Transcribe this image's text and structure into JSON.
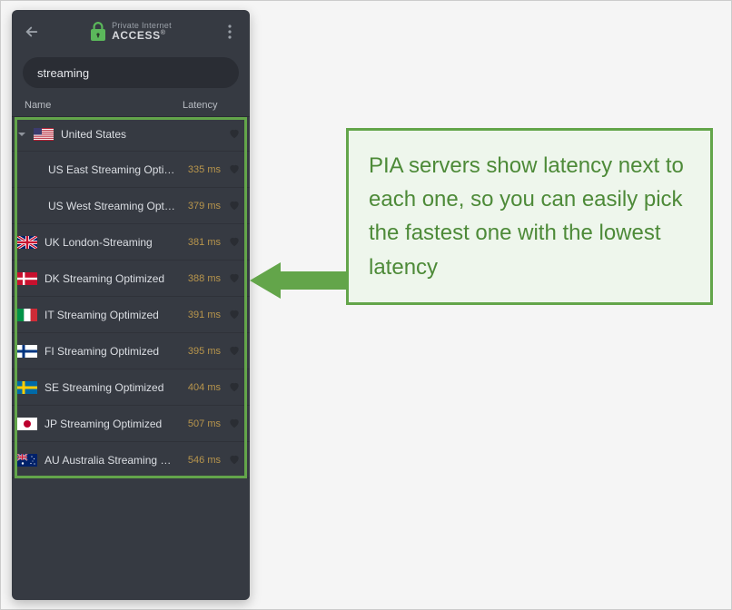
{
  "brand": {
    "line1": "Private Internet",
    "line2": "ACCESS",
    "reg": "®"
  },
  "search": {
    "value": "streaming"
  },
  "columns": {
    "name": "Name",
    "latency": "Latency"
  },
  "group": {
    "label": "United States",
    "flag": "us",
    "children": [
      {
        "name": "US East Streaming Optimiz…",
        "latency": "335 ms"
      },
      {
        "name": "US West Streaming Optimiz…",
        "latency": "379 ms"
      }
    ]
  },
  "servers": [
    {
      "flag": "uk",
      "name": "UK London-Streaming",
      "latency": "381 ms"
    },
    {
      "flag": "dk",
      "name": "DK Streaming Optimized",
      "latency": "388 ms"
    },
    {
      "flag": "it",
      "name": "IT Streaming Optimized",
      "latency": "391 ms"
    },
    {
      "flag": "fi",
      "name": "FI Streaming Optimized",
      "latency": "395 ms"
    },
    {
      "flag": "se",
      "name": "SE Streaming Optimized",
      "latency": "404 ms"
    },
    {
      "flag": "jp",
      "name": "JP Streaming Optimized",
      "latency": "507 ms"
    },
    {
      "flag": "au",
      "name": "AU Australia Streaming O…",
      "latency": "546 ms"
    }
  ],
  "callout": "PIA servers show latency next to each one, so you can easily pick the fastest one with the lowest latency",
  "flags": {
    "us": "<svg viewBox='0 0 22 14'><rect width='22' height='14' fill='#b22234'/><rect y='1.08' width='22' height='1.08' fill='#fff'/><rect y='3.23' width='22' height='1.08' fill='#fff'/><rect y='5.38' width='22' height='1.08' fill='#fff'/><rect y='7.54' width='22' height='1.08' fill='#fff'/><rect y='9.69' width='22' height='1.08' fill='#fff'/><rect y='11.85' width='22' height='1.08' fill='#fff'/><rect width='9' height='7.5' fill='#3c3b6e'/></svg>",
    "uk": "<svg viewBox='0 0 22 14'><rect width='22' height='14' fill='#012169'/><path d='M0 0L22 14M22 0L0 14' stroke='#fff' stroke-width='3'/><path d='M0 0L22 14M22 0L0 14' stroke='#c8102e' stroke-width='1.4'/><rect x='9' width='4' height='14' fill='#fff'/><rect y='5' width='22' height='4' fill='#fff'/><rect x='9.8' width='2.4' height='14' fill='#c8102e'/><rect y='5.8' width='22' height='2.4' fill='#c8102e'/></svg>",
    "dk": "<svg viewBox='0 0 22 14'><rect width='22' height='14' fill='#c8102e'/><rect x='6' width='2.4' height='14' fill='#fff'/><rect y='5.8' width='22' height='2.4' fill='#fff'/></svg>",
    "it": "<svg viewBox='0 0 22 14'><rect width='7.33' height='14' fill='#009246'/><rect x='7.33' width='7.33' height='14' fill='#fff'/><rect x='14.66' width='7.34' height='14' fill='#ce2b37'/></svg>",
    "fi": "<svg viewBox='0 0 22 14'><rect width='22' height='14' fill='#fff'/><rect x='5.5' width='3' height='14' fill='#003580'/><rect y='5.5' width='22' height='3' fill='#003580'/></svg>",
    "se": "<svg viewBox='0 0 22 14'><rect width='22' height='14' fill='#006aa7'/><rect x='5.5' width='3' height='14' fill='#fecc00'/><rect y='5.5' width='22' height='3' fill='#fecc00'/></svg>",
    "jp": "<svg viewBox='0 0 22 14'><rect width='22' height='14' fill='#fff'/><circle cx='11' cy='7' r='4' fill='#bc002d'/></svg>",
    "au": "<svg viewBox='0 0 22 14'><rect width='22' height='14' fill='#012169'/><g transform='scale(0.5)'><rect width='22' height='14' fill='#012169'/><path d='M0 0L22 14M22 0L0 14' stroke='#fff' stroke-width='3'/><path d='M0 0L22 14M22 0L0 14' stroke='#c8102e' stroke-width='1.4'/><rect x='9' width='4' height='14' fill='#fff'/><rect y='5' width='22' height='4' fill='#fff'/><rect x='9.8' width='2.4' height='14' fill='#c8102e'/><rect y='5.8' width='22' height='2.4' fill='#c8102e'/></g><g fill='#fff'><circle cx='6' cy='10.5' r='1.2'/><circle cx='16' cy='3' r='0.6'/><circle cx='18.5' cy='5.5' r='0.6'/><circle cx='17' cy='8' r='0.5'/><circle cx='15' cy='10.5' r='0.6'/><circle cx='19' cy='11' r='0.6'/></g></svg>"
  }
}
